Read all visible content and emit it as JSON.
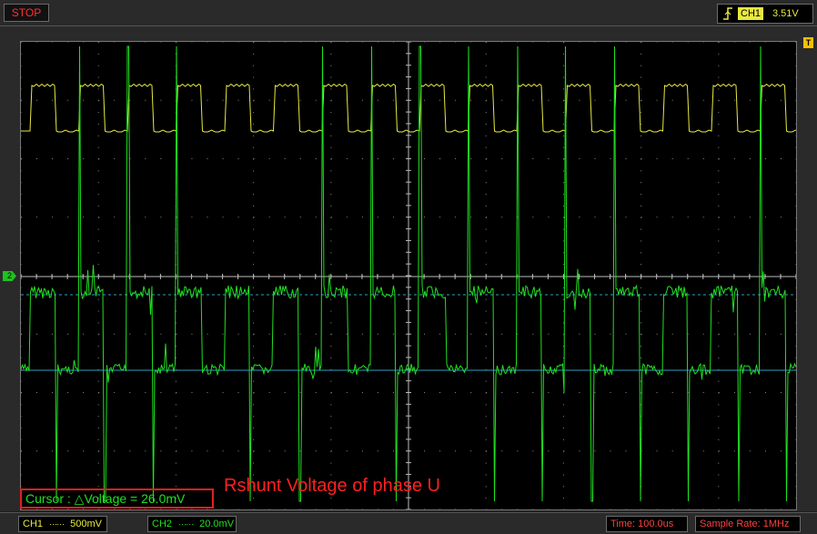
{
  "status": {
    "label": "STOP",
    "color": "#ff3030"
  },
  "trigger": {
    "edge_icon": "rising-edge-icon",
    "channel": "CH1",
    "level": "3.51V"
  },
  "markers": {
    "trigger_position": "T",
    "ch2_ground": "2"
  },
  "cursor_readout": "Cursor : △Voltage = 26.0mV",
  "annotation": "Rshunt Voltage of phase U",
  "bottom": {
    "ch1": {
      "label": "CH1",
      "coupling_icon": "dc-coupling-icon",
      "scale": "500mV"
    },
    "ch2": {
      "label": "CH2",
      "coupling_icon": "dc-coupling-icon",
      "scale": "20.0mV"
    },
    "time": "Time: 100.0us",
    "sample_rate": "Sample Rate: 1MHz"
  },
  "colors": {
    "ch1": "#e8e840",
    "ch2": "#20e020",
    "cursor": "#2aa0c0",
    "grid": "#ffffff",
    "background": "#000000"
  }
}
